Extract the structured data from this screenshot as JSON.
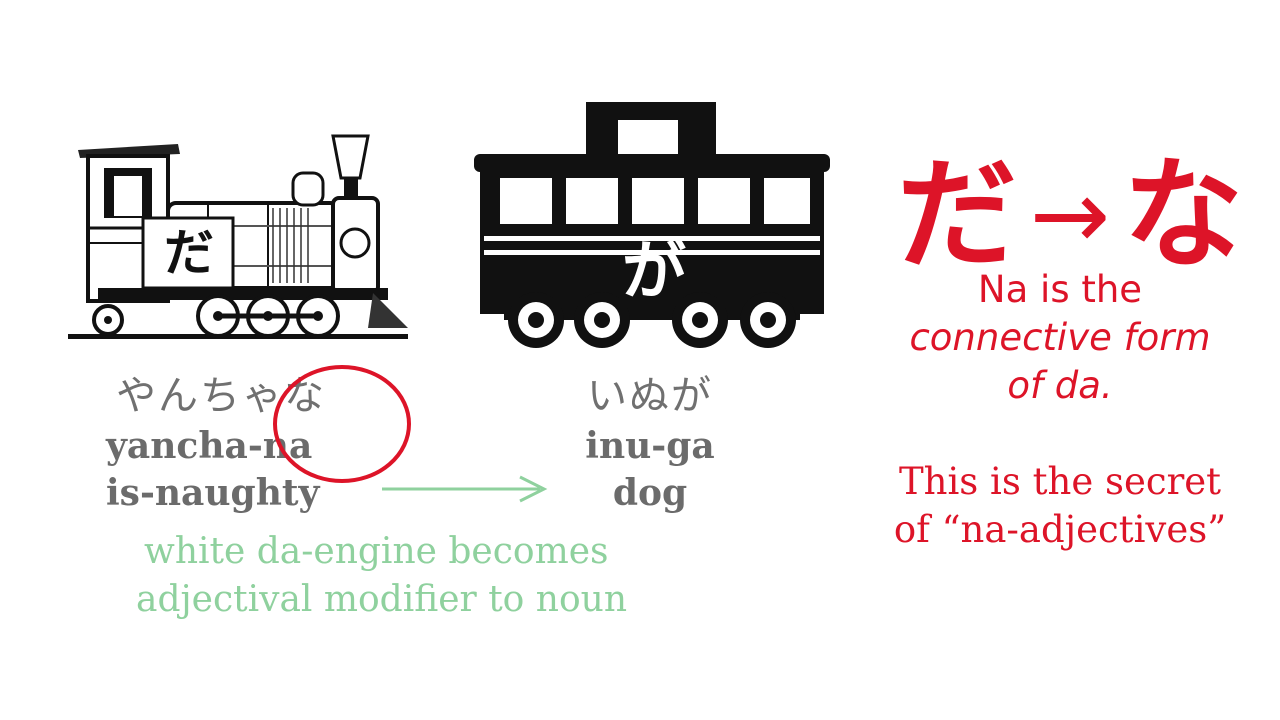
{
  "engine": {
    "kana": "だ",
    "icon": "steam-locomotive"
  },
  "car": {
    "kana": "が",
    "icon": "train-car"
  },
  "left_phrase": {
    "kana": "やんちゃな",
    "romaji": "yancha-na",
    "gloss": "is-naughty"
  },
  "right_phrase": {
    "kana": "いぬが",
    "romaji": "inu-ga",
    "gloss": "dog"
  },
  "note": {
    "line1": "white da-engine becomes",
    "line2": "adjectival modifier to noun"
  },
  "equation": {
    "from": "だ",
    "arrow": "→",
    "to": "な"
  },
  "explanation": {
    "line1": "Na is the",
    "line2": "connective form",
    "line3": "of da.",
    "line4": "This is the secret",
    "line5": "of “na-adjectives”"
  },
  "colors": {
    "red": "#dd1428",
    "green": "#8fd19e",
    "gray": "#6b6b6b",
    "black": "#111111"
  }
}
